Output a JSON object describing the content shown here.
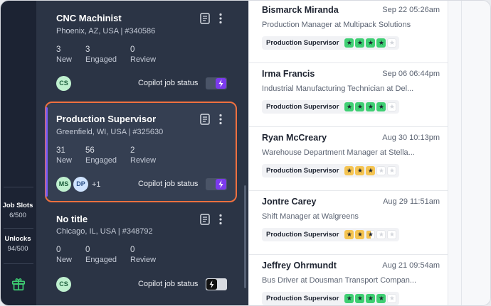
{
  "rail": {
    "job_slots_label": "Job Slots",
    "job_slots_value": "6/500",
    "unlocks_label": "Unlocks",
    "unlocks_value": "94/500",
    "gift_icon": "gift-icon"
  },
  "jobs": [
    {
      "title": "CNC Machinist",
      "location": "Phoenix, AZ, USA | #340586",
      "new": "3",
      "new_label": "New",
      "engaged": "3",
      "engaged_label": "Engaged",
      "review": "0",
      "review_label": "Review",
      "avatars": [
        "CS"
      ],
      "extra": "",
      "copilot_label": "Copilot job status",
      "copilot_on": true
    },
    {
      "title": "Production Supervisor",
      "location": "Greenfield, WI, USA | #325630",
      "new": "31",
      "new_label": "New",
      "engaged": "56",
      "engaged_label": "Engaged",
      "review": "2",
      "review_label": "Review",
      "avatars": [
        "MS",
        "DP"
      ],
      "extra": "+1",
      "copilot_label": "Copilot job status",
      "copilot_on": true
    },
    {
      "title": "No title",
      "location": "Chicago, IL, USA | #348792",
      "new": "0",
      "new_label": "New",
      "engaged": "0",
      "engaged_label": "Engaged",
      "review": "0",
      "review_label": "Review",
      "avatars": [
        "CS"
      ],
      "extra": "",
      "copilot_label": "Copilot job status",
      "copilot_on": false
    }
  ],
  "candidates": [
    {
      "name": "Bismarck Miranda",
      "date": "Sep 22 05:26am",
      "role": "Production Manager at Multipack Solutions",
      "tag": "Production Supervisor",
      "rating": [
        "green",
        "green",
        "green",
        "green",
        "empty"
      ]
    },
    {
      "name": "Irma Francis",
      "date": "Sep 06 06:44pm",
      "role": "Industrial Manufacturing Technician at Del...",
      "tag": "Production Supervisor",
      "rating": [
        "green",
        "green",
        "green",
        "green",
        "empty"
      ]
    },
    {
      "name": "Ryan McCreary",
      "date": "Aug 30 10:13pm",
      "role": "Warehouse Department Manager at Stella...",
      "tag": "Production Supervisor",
      "rating": [
        "yellow",
        "yellow",
        "yellow",
        "empty",
        "empty"
      ]
    },
    {
      "name": "Jontre Carey",
      "date": "Aug 29 11:51am",
      "role": "Shift Manager at Walgreens",
      "tag": "Production Supervisor",
      "rating": [
        "yellow",
        "yellow",
        "half",
        "empty",
        "empty"
      ]
    },
    {
      "name": "Jeffrey Ohrmundt",
      "date": "Aug 21 09:54am",
      "role": "Bus Driver at Dousman Transport Compan...",
      "tag": "Production Supervisor",
      "rating": [
        "green",
        "green",
        "green",
        "green",
        "empty"
      ]
    }
  ],
  "colors": {
    "accent": "#7c3aed",
    "highlight": "#f0703f",
    "green": "#3fcf73",
    "yellow": "#f5c451"
  }
}
